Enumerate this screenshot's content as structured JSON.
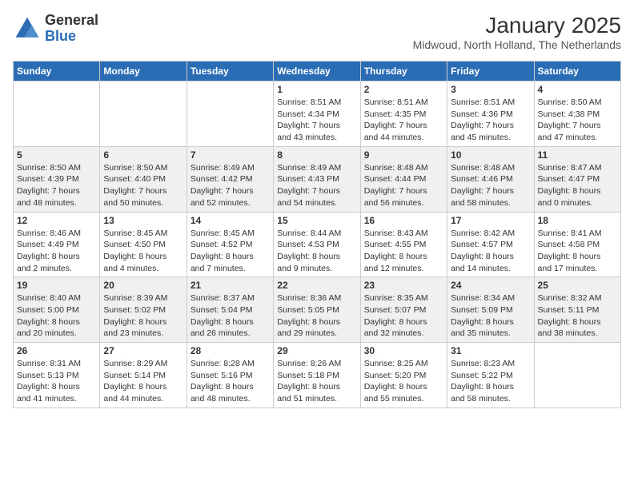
{
  "logo": {
    "general": "General",
    "blue": "Blue"
  },
  "header": {
    "month": "January 2025",
    "location": "Midwoud, North Holland, The Netherlands"
  },
  "weekdays": [
    "Sunday",
    "Monday",
    "Tuesday",
    "Wednesday",
    "Thursday",
    "Friday",
    "Saturday"
  ],
  "weeks": [
    [
      {
        "day": "",
        "info": ""
      },
      {
        "day": "",
        "info": ""
      },
      {
        "day": "",
        "info": ""
      },
      {
        "day": "1",
        "info": "Sunrise: 8:51 AM\nSunset: 4:34 PM\nDaylight: 7 hours\nand 43 minutes."
      },
      {
        "day": "2",
        "info": "Sunrise: 8:51 AM\nSunset: 4:35 PM\nDaylight: 7 hours\nand 44 minutes."
      },
      {
        "day": "3",
        "info": "Sunrise: 8:51 AM\nSunset: 4:36 PM\nDaylight: 7 hours\nand 45 minutes."
      },
      {
        "day": "4",
        "info": "Sunrise: 8:50 AM\nSunset: 4:38 PM\nDaylight: 7 hours\nand 47 minutes."
      }
    ],
    [
      {
        "day": "5",
        "info": "Sunrise: 8:50 AM\nSunset: 4:39 PM\nDaylight: 7 hours\nand 48 minutes."
      },
      {
        "day": "6",
        "info": "Sunrise: 8:50 AM\nSunset: 4:40 PM\nDaylight: 7 hours\nand 50 minutes."
      },
      {
        "day": "7",
        "info": "Sunrise: 8:49 AM\nSunset: 4:42 PM\nDaylight: 7 hours\nand 52 minutes."
      },
      {
        "day": "8",
        "info": "Sunrise: 8:49 AM\nSunset: 4:43 PM\nDaylight: 7 hours\nand 54 minutes."
      },
      {
        "day": "9",
        "info": "Sunrise: 8:48 AM\nSunset: 4:44 PM\nDaylight: 7 hours\nand 56 minutes."
      },
      {
        "day": "10",
        "info": "Sunrise: 8:48 AM\nSunset: 4:46 PM\nDaylight: 7 hours\nand 58 minutes."
      },
      {
        "day": "11",
        "info": "Sunrise: 8:47 AM\nSunset: 4:47 PM\nDaylight: 8 hours\nand 0 minutes."
      }
    ],
    [
      {
        "day": "12",
        "info": "Sunrise: 8:46 AM\nSunset: 4:49 PM\nDaylight: 8 hours\nand 2 minutes."
      },
      {
        "day": "13",
        "info": "Sunrise: 8:45 AM\nSunset: 4:50 PM\nDaylight: 8 hours\nand 4 minutes."
      },
      {
        "day": "14",
        "info": "Sunrise: 8:45 AM\nSunset: 4:52 PM\nDaylight: 8 hours\nand 7 minutes."
      },
      {
        "day": "15",
        "info": "Sunrise: 8:44 AM\nSunset: 4:53 PM\nDaylight: 8 hours\nand 9 minutes."
      },
      {
        "day": "16",
        "info": "Sunrise: 8:43 AM\nSunset: 4:55 PM\nDaylight: 8 hours\nand 12 minutes."
      },
      {
        "day": "17",
        "info": "Sunrise: 8:42 AM\nSunset: 4:57 PM\nDaylight: 8 hours\nand 14 minutes."
      },
      {
        "day": "18",
        "info": "Sunrise: 8:41 AM\nSunset: 4:58 PM\nDaylight: 8 hours\nand 17 minutes."
      }
    ],
    [
      {
        "day": "19",
        "info": "Sunrise: 8:40 AM\nSunset: 5:00 PM\nDaylight: 8 hours\nand 20 minutes."
      },
      {
        "day": "20",
        "info": "Sunrise: 8:39 AM\nSunset: 5:02 PM\nDaylight: 8 hours\nand 23 minutes."
      },
      {
        "day": "21",
        "info": "Sunrise: 8:37 AM\nSunset: 5:04 PM\nDaylight: 8 hours\nand 26 minutes."
      },
      {
        "day": "22",
        "info": "Sunrise: 8:36 AM\nSunset: 5:05 PM\nDaylight: 8 hours\nand 29 minutes."
      },
      {
        "day": "23",
        "info": "Sunrise: 8:35 AM\nSunset: 5:07 PM\nDaylight: 8 hours\nand 32 minutes."
      },
      {
        "day": "24",
        "info": "Sunrise: 8:34 AM\nSunset: 5:09 PM\nDaylight: 8 hours\nand 35 minutes."
      },
      {
        "day": "25",
        "info": "Sunrise: 8:32 AM\nSunset: 5:11 PM\nDaylight: 8 hours\nand 38 minutes."
      }
    ],
    [
      {
        "day": "26",
        "info": "Sunrise: 8:31 AM\nSunset: 5:13 PM\nDaylight: 8 hours\nand 41 minutes."
      },
      {
        "day": "27",
        "info": "Sunrise: 8:29 AM\nSunset: 5:14 PM\nDaylight: 8 hours\nand 44 minutes."
      },
      {
        "day": "28",
        "info": "Sunrise: 8:28 AM\nSunset: 5:16 PM\nDaylight: 8 hours\nand 48 minutes."
      },
      {
        "day": "29",
        "info": "Sunrise: 8:26 AM\nSunset: 5:18 PM\nDaylight: 8 hours\nand 51 minutes."
      },
      {
        "day": "30",
        "info": "Sunrise: 8:25 AM\nSunset: 5:20 PM\nDaylight: 8 hours\nand 55 minutes."
      },
      {
        "day": "31",
        "info": "Sunrise: 8:23 AM\nSunset: 5:22 PM\nDaylight: 8 hours\nand 58 minutes."
      },
      {
        "day": "",
        "info": ""
      }
    ]
  ],
  "row_shading": [
    false,
    true,
    false,
    true,
    false
  ]
}
